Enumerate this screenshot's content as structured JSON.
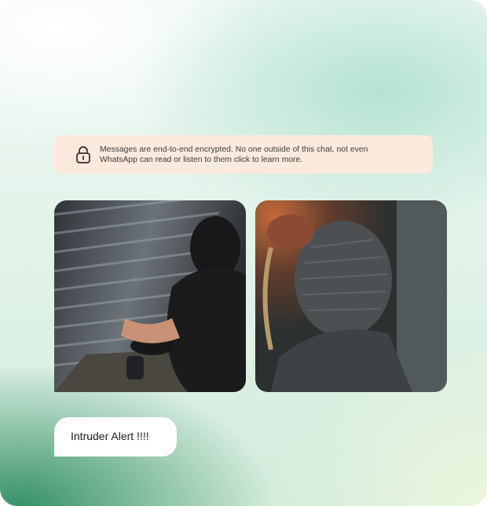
{
  "encryption_notice": {
    "icon": "lock-icon",
    "text": "Messages are end-to-end encrypted. No one outside of this chat, not even WhatsApp can read or listen to them click to learn more."
  },
  "media": [
    {
      "icon": "photo-thumbnail"
    },
    {
      "icon": "photo-thumbnail"
    }
  ],
  "message": {
    "text": "Intruder Alert !!!!",
    "bubble_color": "#ffffff"
  },
  "colors": {
    "notice_bg": "#fbe9dd",
    "accent_green": "#2f8c64"
  }
}
